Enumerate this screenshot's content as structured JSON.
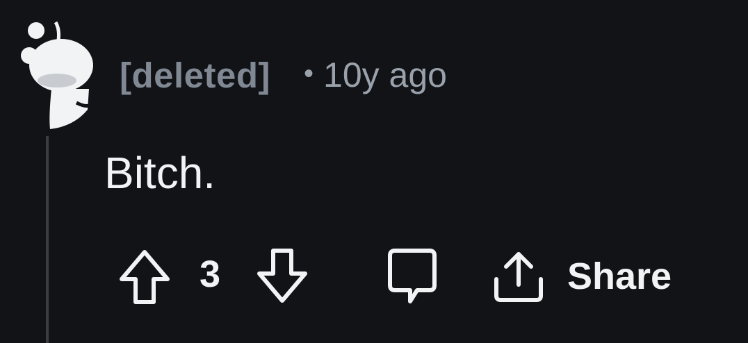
{
  "comment": {
    "author": "[deleted]",
    "separator": "•",
    "timestamp": "10y ago",
    "body": "Bitch.",
    "avatar_icon": "snoo-avatar-icon"
  },
  "actions": {
    "upvote_icon": "arrow-up-icon",
    "vote_count": "3",
    "downvote_icon": "arrow-down-icon",
    "reply_icon": "speech-bubble-icon",
    "share_icon": "share-icon",
    "share_label": "Share"
  },
  "colors": {
    "background": "#121317",
    "meta_text": "#99a1ab",
    "author_text": "#808893",
    "primary_text": "#f2f3f5",
    "thread_line": "#3a3d42"
  }
}
